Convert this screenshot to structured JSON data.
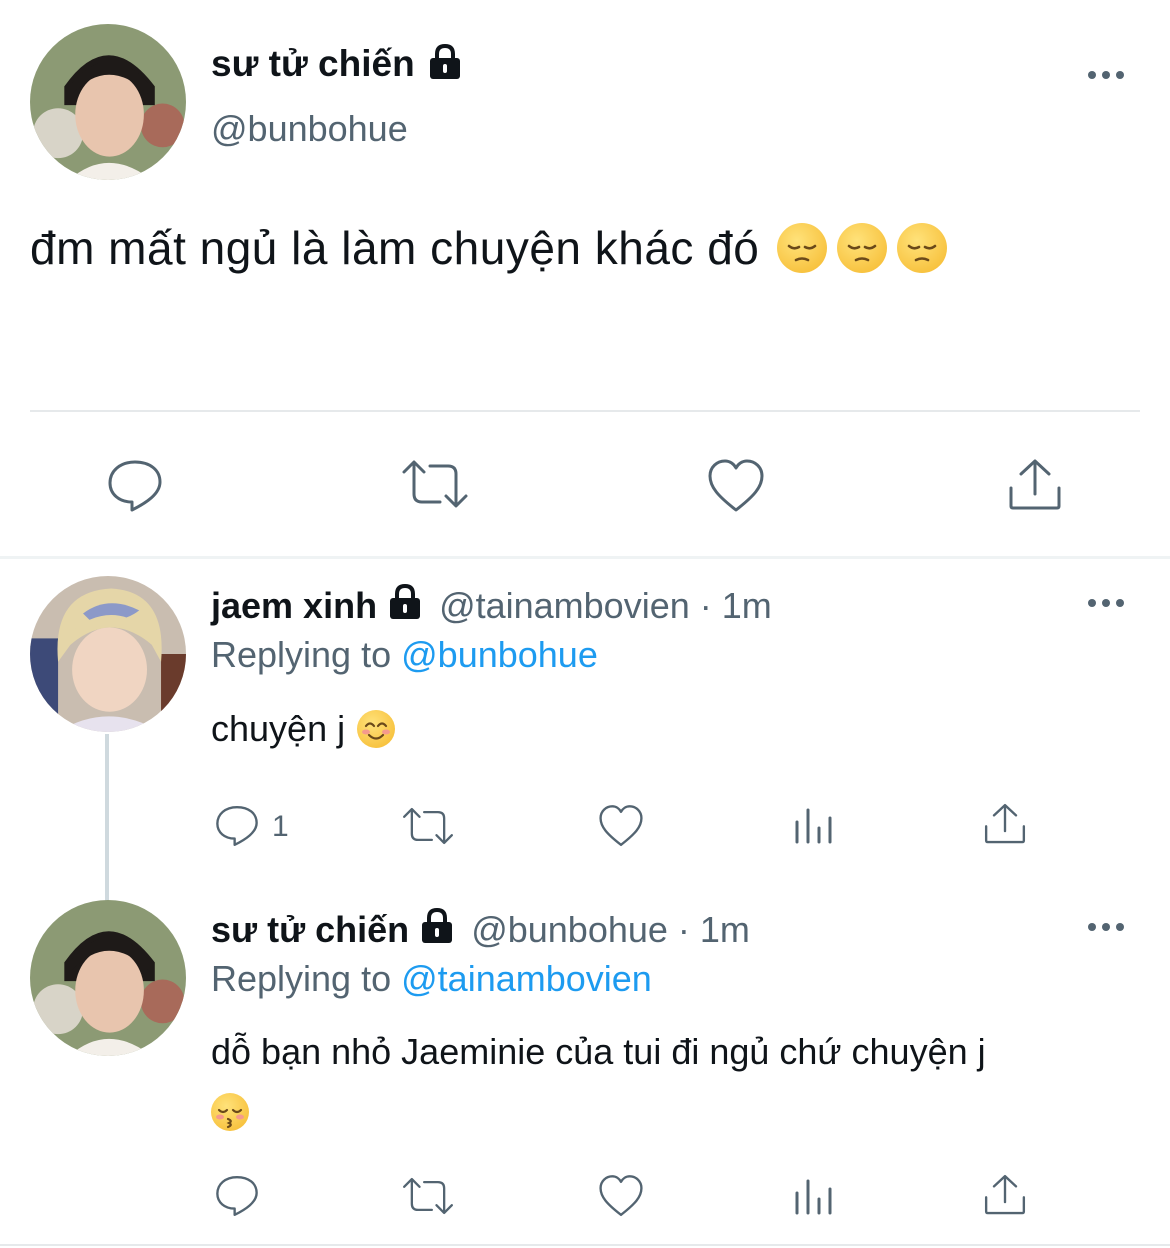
{
  "main_tweet": {
    "display_name": "sư tử chiến",
    "handle": "@bunbohue",
    "text": "đm mất ngủ là làm chuyện khác đó",
    "emoji": [
      "pensive-face",
      "pensive-face",
      "pensive-face"
    ]
  },
  "replies": [
    {
      "display_name": "jaem xinh",
      "handle": "@tainambovien",
      "time": "· 1m",
      "replying_label": "Replying to",
      "replying_to": "@bunbohue",
      "text": "chuyện j",
      "emoji": "smiling-face-with-smiling-eyes",
      "reply_count": "1"
    },
    {
      "display_name": "sư tử chiến",
      "handle": "@bunbohue",
      "time": "· 1m",
      "replying_label": "Replying to",
      "replying_to": "@tainambovien",
      "text": "dỗ bạn nhỏ Jaeminie của tui đi ngủ chứ chuyện j",
      "emoji": "kissing-face-with-closed-eyes"
    }
  ],
  "colors": {
    "text": "#0f1419",
    "secondary": "#536471",
    "link": "#1d9bf0",
    "divider": "#e6e9eb",
    "emoji": "#f9c23c"
  }
}
